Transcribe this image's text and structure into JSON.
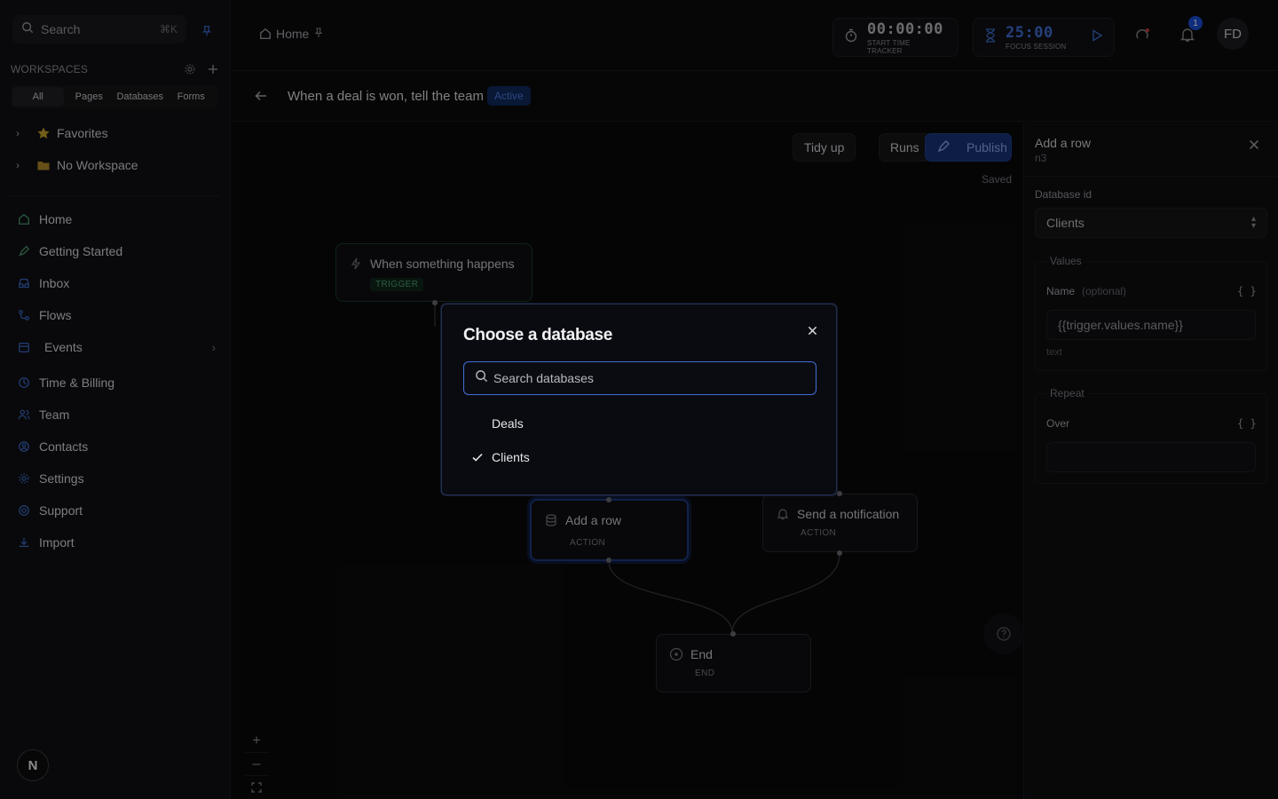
{
  "sidebar": {
    "search": {
      "label": "Search",
      "shortcut": "⌘K"
    },
    "workspaces_label": "WORKSPACES",
    "filters": [
      "All",
      "Pages",
      "Databases",
      "Forms"
    ],
    "tree": [
      {
        "label": "Favorites"
      },
      {
        "label": "No Workspace"
      }
    ],
    "nav": [
      {
        "label": "Home"
      },
      {
        "label": "Getting Started"
      },
      {
        "label": "Inbox"
      },
      {
        "label": "Flows"
      },
      {
        "label": "Events"
      },
      {
        "label": "Time & Billing"
      },
      {
        "label": "Team"
      },
      {
        "label": "Contacts"
      },
      {
        "label": "Settings"
      },
      {
        "label": "Support"
      },
      {
        "label": "Import"
      }
    ],
    "logo": "N"
  },
  "topbar": {
    "breadcrumb": "Home",
    "time_tracker": {
      "value": "00:00:00",
      "label": "START TIME TRACKER"
    },
    "focus": {
      "value": "25:00",
      "label": "FOCUS SESSION"
    },
    "notifications_count": "1",
    "avatar_initials": "FD"
  },
  "flow": {
    "title": "When a deal is won, tell the team",
    "status": "Active",
    "toolbar": {
      "tidy": "Tidy up",
      "runs": "Runs",
      "publish": "Publish"
    },
    "saved": "Saved",
    "nodes": {
      "trigger": {
        "title": "When something happens",
        "type": "TRIGGER"
      },
      "add_row": {
        "title": "Add a row",
        "type": "ACTION"
      },
      "notify": {
        "title": "Send a notification",
        "type": "ACTION"
      },
      "end": {
        "title": "End",
        "type": "END"
      }
    }
  },
  "panel": {
    "title": "Add a row",
    "subtitle": "n3",
    "database_label": "Database id",
    "database_value": "Clients",
    "values_legend": "Values",
    "name_label": "Name",
    "name_optional": "(optional)",
    "braces": "{ }",
    "name_value": "{{trigger.values.name}}",
    "name_type": "text",
    "repeat_legend": "Repeat",
    "over_label": "Over"
  },
  "modal": {
    "title": "Choose a database",
    "search_placeholder": "Search databases",
    "options": [
      {
        "label": "Deals",
        "selected": false
      },
      {
        "label": "Clients",
        "selected": true
      }
    ]
  },
  "colors": {
    "accent": "#3f6fd6",
    "status_bg": "#0f2a5c",
    "trigger_green": "#4aa071"
  }
}
